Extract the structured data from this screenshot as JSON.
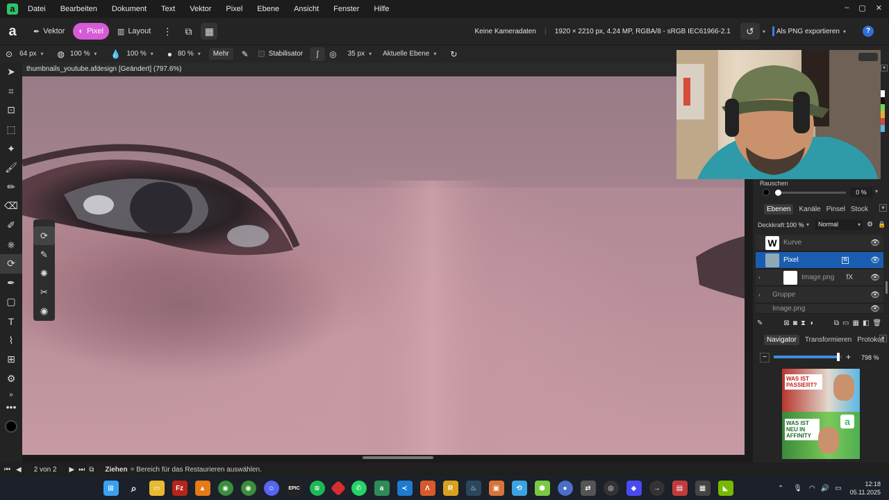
{
  "menubar": {
    "items": [
      "Datei",
      "Bearbeiten",
      "Dokument",
      "Text",
      "Vektor",
      "Pixel",
      "Ebene",
      "Ansicht",
      "Fenster",
      "Hilfe"
    ],
    "window_controls": [
      "–",
      "▢",
      "✕"
    ]
  },
  "toolbar": {
    "personas": [
      "Vektor",
      "Pixel",
      "Layout"
    ],
    "active_persona": "Pixel",
    "camera_info": "Keine Kameradaten",
    "doc_info": "1920 × 2210 px, 4.24 MP, RGBA/8 - sRGB IEC61966-2.1",
    "export_label": "Als PNG exportieren"
  },
  "context_bar": {
    "size": "64 px",
    "opacity": "100 %",
    "flow": "100 %",
    "hardness": "80 %",
    "more_label": "Mehr",
    "stabilizer_label": "Stabilisator",
    "spacing": "35 px",
    "source": "Aktuelle Ebene"
  },
  "document": {
    "tab_title": "thumbnails_youtube.afdesign [Geändert] (797.6%)"
  },
  "right_panel": {
    "noise_label": "Rauschen",
    "noise_value": "0 %",
    "layers_tabs": [
      "Ebenen",
      "Kanäle",
      "Pinsel",
      "Stock"
    ],
    "opacity_label": "Deckkraft:",
    "opacity_value": "100 %",
    "blend_mode": "Normal",
    "layers": [
      {
        "name": "Kurve",
        "selected": false,
        "fx": ""
      },
      {
        "name": "Pixel",
        "selected": true,
        "fx": ""
      },
      {
        "name": "Image.png",
        "selected": false,
        "fx": "fX"
      },
      {
        "name": "Gruppe",
        "selected": false,
        "fx": ""
      },
      {
        "name": "Image.png",
        "selected": false,
        "fx": ""
      }
    ],
    "navigator_tabs": [
      "Navigator",
      "Transformieren",
      "Protokoll"
    ],
    "zoom_value": "798 %",
    "zoom_fraction": 0.95,
    "thumbnail_texts": [
      "WAS IST PASSIERT?",
      "WAS IST NEU IN AFFINITY"
    ]
  },
  "statusbar": {
    "page_info": "2 von 2",
    "hint_bold": "Ziehen",
    "hint_text": "= Bereich für das Restaurieren auswählen."
  },
  "taskbar": {
    "icons": [
      "windows-icon",
      "search-icon",
      "explorer-icon",
      "filezilla-icon",
      "vlc-icon",
      "chrome-icon",
      "chrome-alt-icon",
      "discord-icon",
      "epic-icon",
      "spotify-icon",
      "red-app-icon",
      "whatsapp-icon",
      "affinity-icon",
      "vscode-icon",
      "affinity-publisher-icon",
      "app-icon",
      "steam-icon",
      "app-icon-2",
      "app-icon-3",
      "app-icon-4",
      "app-icon-5",
      "app-icon-6",
      "app-icon-7",
      "app-icon-8",
      "app-icon-9",
      "app-icon-10",
      "app-icon-11",
      "nvidia-icon"
    ],
    "time": "12:18",
    "date": "05.11.2025"
  },
  "colors": {
    "accent": "#d65bd6",
    "selection": "#1a5db0",
    "affinity_green": "#31c36a"
  }
}
